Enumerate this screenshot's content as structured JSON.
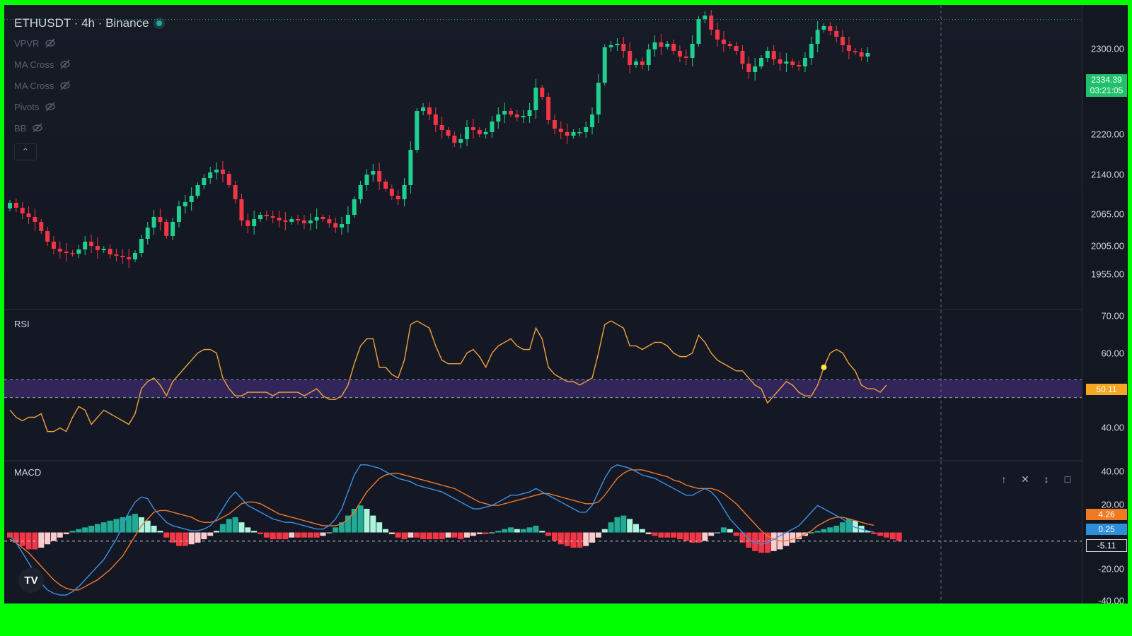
{
  "header": {
    "symbol_title": "ETHUSDT · 4h · Binance",
    "indicators": [
      {
        "label": "VPVR"
      },
      {
        "label": "MA Cross"
      },
      {
        "label": "MA Cross"
      },
      {
        "label": "Pivots"
      },
      {
        "label": "BB"
      }
    ],
    "collapse_icon": "chevron-up-icon"
  },
  "colors": {
    "up": "#26a69a",
    "up_bright": "#1fcf8f",
    "down": "#ef5350",
    "down_bright": "#f23645",
    "rsi_line": "#f0a23b",
    "rsi_band": "#3b2a6b",
    "macd_line": "#3c8fe6",
    "signal_line": "#f0772b",
    "background": "#131722",
    "frame": "#00ff00",
    "price_badge": "#1fc26a",
    "rsi_badge": "#f5a623",
    "signal_badge": "#f07a22",
    "macd_badge": "#2d8fd8"
  },
  "price_axis": {
    "ticks": [
      "2300.00",
      "2220.00",
      "2140.00",
      "2065.00",
      "2005.00",
      "1955.00"
    ],
    "last_price": "2334.39",
    "countdown": "03:21:05"
  },
  "rsi_pane": {
    "label": "RSI",
    "ticks": [
      "70.00",
      "60.00",
      "40.00"
    ],
    "value_badge": "50.11"
  },
  "macd_pane": {
    "label": "MACD",
    "ticks": [
      "40.00",
      "20.00",
      "-20.00",
      "-40.00"
    ],
    "macd_badge": "0.25",
    "signal_badge": "4.26",
    "hist_badge": "-5.11",
    "controls": [
      "arrow-up-icon",
      "close-icon",
      "collapse-icon",
      "maximize-icon"
    ]
  },
  "branding": {
    "logo_text": "TV"
  },
  "chart_data": [
    {
      "type": "candlestick",
      "title": "ETHUSDT · 4h · Binance",
      "ylim": [
        1935,
        2345
      ],
      "last_price": 2334.39,
      "closes": [
        2075,
        2068,
        2060,
        2055,
        2048,
        2035,
        2020,
        2010,
        2006,
        2004,
        2003,
        2009,
        2020,
        2014,
        2008,
        2010,
        2002,
        2000,
        1998,
        1995,
        2004,
        2024,
        2040,
        2055,
        2048,
        2028,
        2048,
        2070,
        2076,
        2085,
        2100,
        2110,
        2118,
        2122,
        2116,
        2100,
        2080,
        2050,
        2042,
        2052,
        2058,
        2056,
        2054,
        2050,
        2048,
        2052,
        2050,
        2046,
        2050,
        2055,
        2052,
        2046,
        2040,
        2045,
        2058,
        2080,
        2100,
        2115,
        2120,
        2105,
        2095,
        2085,
        2080,
        2100,
        2150,
        2205,
        2210,
        2200,
        2185,
        2178,
        2170,
        2160,
        2165,
        2182,
        2178,
        2172,
        2175,
        2190,
        2200,
        2205,
        2200,
        2196,
        2198,
        2206,
        2238,
        2225,
        2192,
        2180,
        2175,
        2170,
        2175,
        2175,
        2182,
        2200,
        2245,
        2295,
        2298,
        2300,
        2290,
        2270,
        2275,
        2270,
        2292,
        2302,
        2296,
        2300,
        2290,
        2282,
        2280,
        2300,
        2335,
        2340,
        2320,
        2306,
        2300,
        2297,
        2290,
        2272,
        2260,
        2268,
        2280,
        2290,
        2278,
        2272,
        2275,
        2270,
        2268,
        2280,
        2300,
        2320,
        2325,
        2318,
        2310,
        2298,
        2290,
        2288,
        2282,
        2287
      ]
    },
    {
      "type": "line",
      "title": "RSI",
      "ylim": [
        30,
        72
      ],
      "band": [
        47.5,
        52.5
      ],
      "values": [
        44,
        42,
        41,
        42,
        42,
        43,
        38,
        38,
        39,
        38,
        42,
        45,
        44,
        40,
        42,
        44,
        43,
        42,
        41,
        40,
        43,
        50,
        52,
        53,
        51,
        48,
        52,
        54,
        56,
        58,
        60,
        61,
        61,
        60,
        53,
        50,
        48,
        48,
        49,
        49,
        49,
        49,
        48,
        49,
        49,
        49,
        49,
        48,
        49,
        50,
        48,
        47,
        47,
        48,
        51,
        57,
        62,
        64,
        64,
        56,
        56,
        54,
        53,
        58,
        68,
        69,
        68,
        67,
        62,
        58,
        57,
        57,
        57,
        60,
        61,
        59,
        56,
        60,
        62,
        63,
        64,
        62,
        61,
        61,
        67,
        64,
        56,
        54,
        53,
        52,
        52,
        51,
        52,
        53,
        60,
        68,
        69,
        68,
        67,
        62,
        62,
        61,
        62,
        63,
        63,
        62,
        60,
        59,
        59,
        60,
        65,
        63,
        60,
        58,
        57,
        56,
        55,
        55,
        53,
        51,
        50,
        46,
        48,
        50,
        52,
        51,
        49,
        48,
        48,
        51,
        56,
        60,
        61,
        60,
        57,
        55,
        51,
        50,
        50,
        49,
        51
      ],
      "current": 50.11
    },
    {
      "type": "line+histogram",
      "title": "MACD",
      "ylim": [
        -42,
        42
      ],
      "zero": 0,
      "macd": [
        -2,
        -6,
        -12,
        -18,
        -24,
        -30,
        -34,
        -36,
        -37,
        -37,
        -35,
        -32,
        -28,
        -24,
        -20,
        -16,
        -10,
        -4,
        4,
        12,
        18,
        21,
        20,
        14,
        10,
        6,
        4,
        3,
        2,
        1,
        1,
        2,
        4,
        8,
        14,
        20,
        24,
        20,
        16,
        14,
        12,
        10,
        8,
        7,
        6,
        6,
        5,
        4,
        3,
        2,
        2,
        4,
        8,
        14,
        24,
        34,
        40,
        40,
        39,
        38,
        36,
        34,
        32,
        31,
        30,
        28,
        27,
        26,
        25,
        24,
        22,
        20,
        18,
        16,
        14,
        14,
        15,
        16,
        18,
        20,
        22,
        22,
        23,
        24,
        26,
        24,
        22,
        20,
        18,
        16,
        14,
        12,
        12,
        16,
        24,
        32,
        38,
        40,
        39,
        38,
        36,
        34,
        33,
        32,
        30,
        28,
        26,
        24,
        22,
        22,
        24,
        26,
        24,
        20,
        14,
        8,
        4,
        0,
        -4,
        -6,
        -7,
        -6,
        -4,
        -2,
        0,
        2,
        4,
        8,
        12,
        16,
        14,
        12,
        10,
        8,
        5,
        3,
        2,
        1,
        0.25
      ],
      "signal": [
        -4,
        -6,
        -9,
        -12,
        -16,
        -20,
        -24,
        -28,
        -31,
        -33,
        -34,
        -34,
        -32,
        -30,
        -28,
        -25,
        -22,
        -18,
        -14,
        -8,
        -2,
        4,
        8,
        12,
        13,
        13,
        12,
        11,
        10,
        9,
        7,
        6,
        6,
        7,
        9,
        11,
        14,
        17,
        18,
        18,
        17,
        15,
        13,
        11,
        10,
        9,
        8,
        7,
        6,
        5,
        4,
        4,
        4,
        5,
        8,
        12,
        18,
        24,
        28,
        32,
        34,
        35,
        35,
        34,
        33,
        32,
        31,
        30,
        29,
        28,
        27,
        26,
        24,
        22,
        20,
        18,
        17,
        16,
        16,
        17,
        18,
        19,
        20,
        21,
        22,
        23,
        23,
        22,
        21,
        20,
        19,
        18,
        17,
        17,
        18,
        22,
        27,
        32,
        35,
        37,
        37,
        37,
        36,
        35,
        34,
        33,
        31,
        30,
        28,
        27,
        26,
        26,
        26,
        25,
        23,
        20,
        17,
        13,
        9,
        5,
        1,
        -2,
        -4,
        -5,
        -5,
        -4,
        -3,
        -1,
        1,
        4,
        6,
        8,
        9,
        9,
        8,
        7,
        6,
        5,
        4.26
      ],
      "histogram": [
        -3,
        -6,
        -8,
        -10,
        -10,
        -9,
        -7,
        -5,
        -3,
        -1,
        1,
        2,
        3,
        4,
        5,
        6,
        7,
        8,
        9,
        10,
        11,
        9,
        7,
        4,
        1,
        -3,
        -6,
        -8,
        -8,
        -7,
        -6,
        -4,
        -2,
        1,
        5,
        8,
        9,
        6,
        3,
        1,
        -1,
        -3,
        -4,
        -4,
        -4,
        -3,
        -3,
        -3,
        -3,
        -3,
        -2,
        0,
        3,
        6,
        10,
        14,
        16,
        14,
        10,
        6,
        2,
        -1,
        -3,
        -4,
        -3,
        -3,
        -4,
        -4,
        -4,
        -4,
        -3,
        -3,
        -4,
        -3,
        -2,
        -1,
        -1,
        0,
        1,
        2,
        3,
        2,
        2,
        3,
        4,
        1,
        -2,
        -5,
        -7,
        -8,
        -9,
        -9,
        -8,
        -6,
        -3,
        2,
        6,
        9,
        10,
        8,
        5,
        2,
        -1,
        -2,
        -3,
        -3,
        -3,
        -4,
        -5,
        -6,
        -6,
        -5,
        -2,
        0,
        3,
        2,
        -2,
        -6,
        -9,
        -11,
        -12,
        -12,
        -11,
        -10,
        -8,
        -6,
        -4,
        -2,
        0,
        1,
        2,
        3,
        4,
        6,
        8,
        7,
        4,
        1,
        -1,
        -2,
        -3,
        -4,
        -5.11
      ]
    }
  ]
}
